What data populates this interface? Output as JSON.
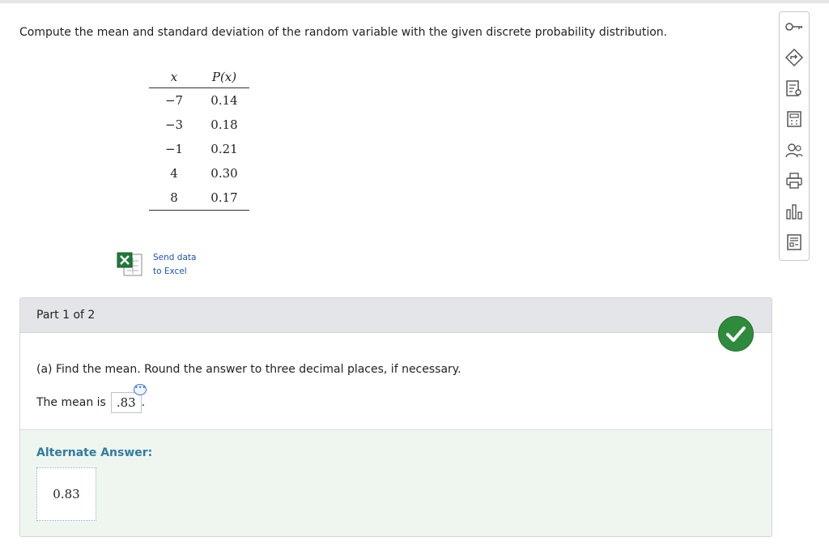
{
  "question": "Compute the mean and standard deviation of the random variable with the given discrete probability distribution.",
  "table": {
    "header_x": "x",
    "header_p": "P(x)",
    "rows": [
      {
        "x": "−7",
        "p": "0.14"
      },
      {
        "x": "−3",
        "p": "0.18"
      },
      {
        "x": "−1",
        "p": "0.21"
      },
      {
        "x": "4",
        "p": "0.30"
      },
      {
        "x": "8",
        "p": "0.17"
      }
    ]
  },
  "excel": {
    "line1": "Send data",
    "line2": "to Excel"
  },
  "part": {
    "header": "Part 1 of 2",
    "question": "(a) Find the mean. Round the answer to three decimal places, if necessary.",
    "mean_label": "The mean is",
    "mean_value": ".83",
    "alt_title": "Alternate Answer:",
    "alt_value": "0.83"
  },
  "toolbar": {
    "icons": [
      "key-icon",
      "diamond-arrow-icon",
      "document-search-icon",
      "calculator-icon",
      "question-people-icon",
      "printer-icon",
      "bar-chart-icon",
      "document-settings-icon"
    ]
  },
  "colors": {
    "check": "#2e8b3c",
    "link": "#1a55b3",
    "alt_title": "#2f7ca3",
    "alt_bg": "#eef6ef"
  }
}
